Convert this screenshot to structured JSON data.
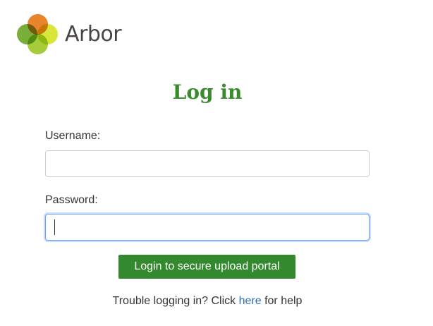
{
  "brand": {
    "name": "Arbor",
    "logo_icon": "arbor-flower-logo-icon",
    "colors": {
      "petal_top": "#e8852a",
      "petal_left": "#7aae3a",
      "petal_right": "#d8e63a",
      "petal_bottom": "#a6cb3b"
    }
  },
  "page": {
    "title": "Log in",
    "title_color": "#3a8a2e"
  },
  "form": {
    "username_label": "Username:",
    "username_value": "",
    "password_label": "Password:",
    "password_value": "",
    "submit_label": "Login to secure upload portal",
    "submit_color": "#338a2e"
  },
  "help": {
    "prefix": "Trouble logging in? Click ",
    "link_text": "here",
    "suffix": " for help",
    "link_color": "#2a6ebb"
  }
}
